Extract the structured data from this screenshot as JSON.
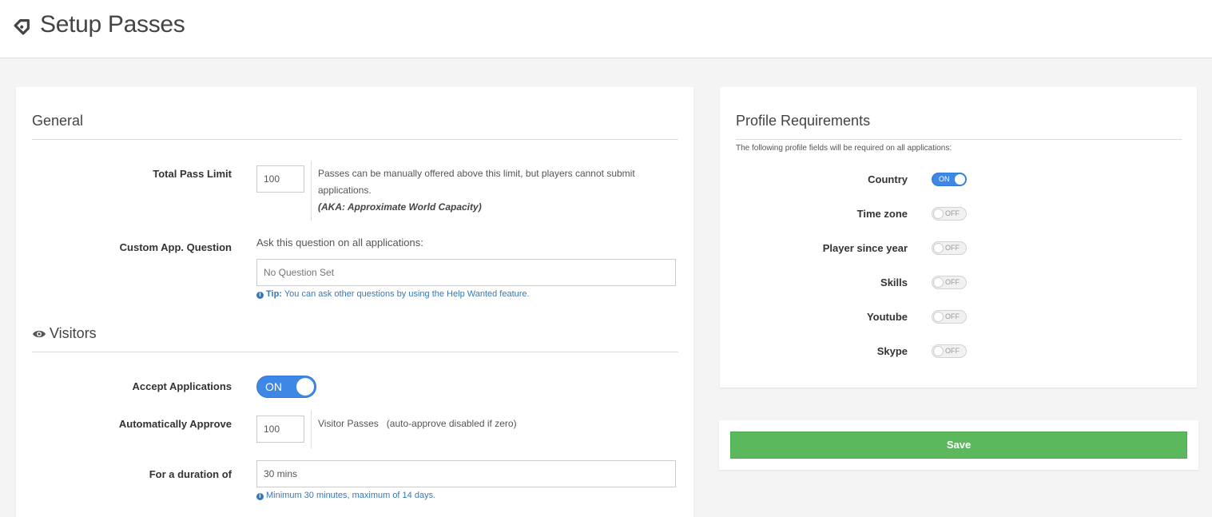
{
  "header": {
    "title": "Setup Passes",
    "icon": "tag-icon"
  },
  "general": {
    "title": "General",
    "total_pass_limit": {
      "label": "Total Pass Limit",
      "value": "100",
      "help_line1": "Passes can be manually offered above this limit, but players cannot submit",
      "help_line2": "applications.",
      "help_note": "(AKA: Approximate World Capacity)"
    },
    "custom_question": {
      "label": "Custom App. Question",
      "prompt": "Ask this question on all applications:",
      "placeholder": "No Question Set",
      "tip_label": "Tip:",
      "tip_text": "You can ask other questions by using the Help Wanted feature."
    }
  },
  "visitors": {
    "title": "Visitors",
    "accept_applications": {
      "label": "Accept Applications",
      "state": "ON"
    },
    "auto_approve": {
      "label": "Automatically Approve",
      "value": "100",
      "help": "Visitor Passes   (auto-approve disabled if zero)"
    },
    "duration": {
      "label": "For a duration of",
      "value": "30 mins",
      "hint": "Minimum 30 minutes, maximum of 14 days."
    }
  },
  "profile_requirements": {
    "title": "Profile Requirements",
    "subtitle": "The following profile fields will be required on all applications:",
    "items": [
      {
        "label": "Country",
        "state": "ON"
      },
      {
        "label": "Time zone",
        "state": "OFF"
      },
      {
        "label": "Player since year",
        "state": "OFF"
      },
      {
        "label": "Skills",
        "state": "OFF"
      },
      {
        "label": "Youtube",
        "state": "OFF"
      },
      {
        "label": "Skype",
        "state": "OFF"
      }
    ]
  },
  "save": {
    "label": "Save"
  },
  "colors": {
    "accent": "#3f87e5",
    "save": "#5cb85c",
    "link": "#3a78b5"
  }
}
